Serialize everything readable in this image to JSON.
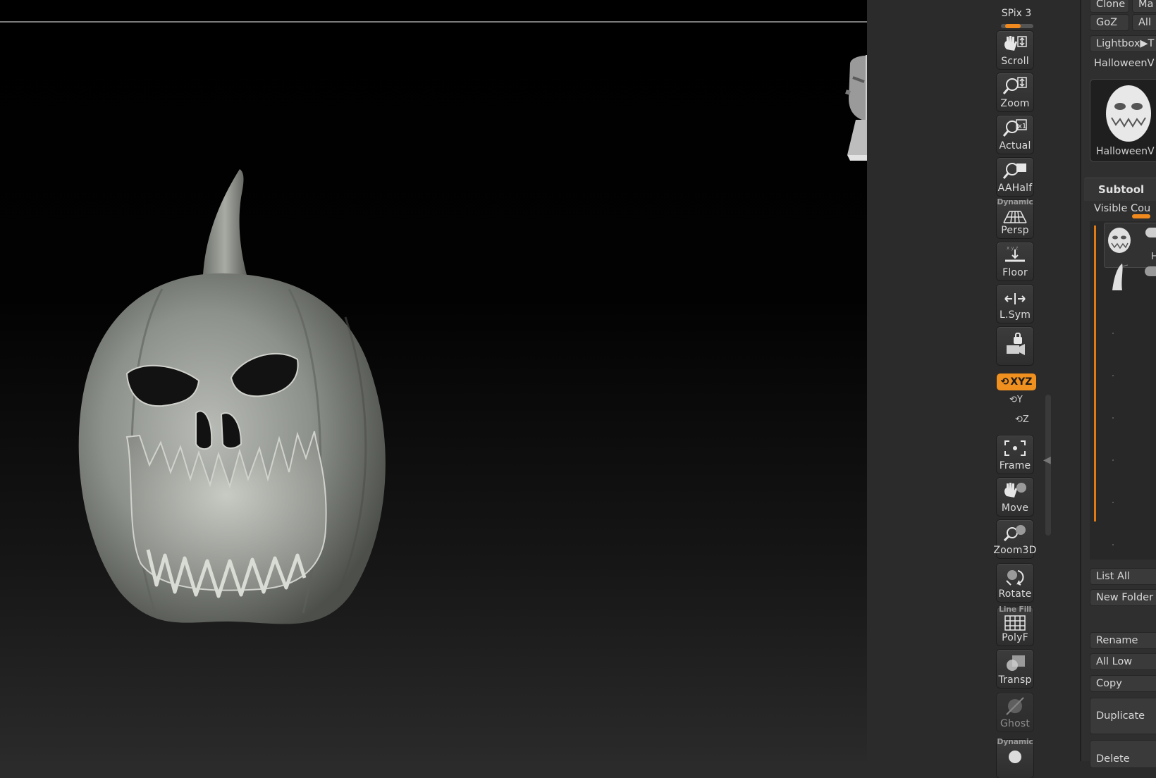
{
  "viewport": {
    "model_label": "Pumpkin model in viewport"
  },
  "dock": {
    "spix_label": "SPix 3",
    "tools": [
      {
        "label": "Scroll",
        "icon": "hand-scroll-icon"
      },
      {
        "label": "Zoom",
        "icon": "magnifier-zoom-icon"
      },
      {
        "label": "Actual",
        "icon": "magnifier-actual-icon"
      },
      {
        "label": "AAHalf",
        "icon": "magnifier-aahalf-icon"
      },
      {
        "label": "Persp",
        "icon": "perspective-grid-icon",
        "tiny": "Dynamic"
      },
      {
        "label": "Floor",
        "icon": "floor-icon"
      },
      {
        "label": "L.Sym",
        "icon": "local-symmetry-icon"
      },
      {
        "label": "",
        "icon": "camera-lock-icon"
      },
      {
        "label": "Frame",
        "icon": "frame-icon"
      },
      {
        "label": "Move",
        "icon": "hand-move-icon"
      },
      {
        "label": "Zoom3D",
        "icon": "zoom3d-icon"
      },
      {
        "label": "Rotate",
        "icon": "rotate-icon"
      },
      {
        "label": "PolyF",
        "icon": "polyframe-icon",
        "tiny": "Line Fill"
      },
      {
        "label": "Transp",
        "icon": "transparency-icon"
      },
      {
        "label": "Ghost",
        "icon": "ghost-icon"
      },
      {
        "label": "",
        "icon": "solo-icon",
        "tiny": "Dynamic"
      }
    ],
    "xyz_label": "XYZ",
    "rot_y": "Y",
    "rot_z": "Z"
  },
  "palette": {
    "clone": "Clone",
    "make": "Ma",
    "goz": "GoZ",
    "all": "All",
    "lightbox": "Lightbox▶T",
    "tool_name": "HalloweenV",
    "thumb_label": "HalloweenV",
    "subtool_title": "Subtool",
    "visible_count": "Visible Cou",
    "subtool_item_label": "H",
    "list_all": "List All",
    "new_folder": "New Folder",
    "rename": "Rename",
    "all_low": "All Low",
    "copy": "Copy",
    "duplicate": "Duplicate",
    "delete": "Delete"
  },
  "colors": {
    "accent": "#f0901e",
    "gizmo_x": "#ff1a1a",
    "gizmo_y": "#19d619",
    "gizmo_z": "#1a1aff"
  }
}
